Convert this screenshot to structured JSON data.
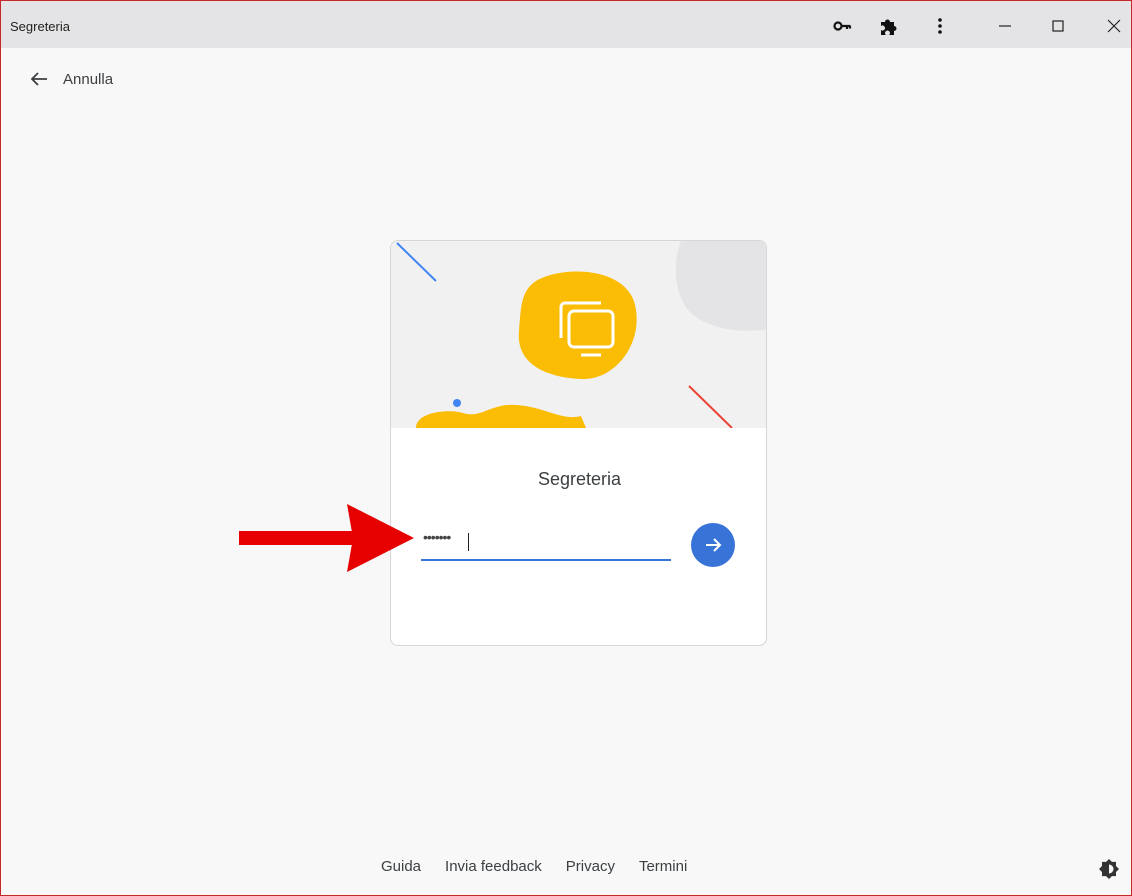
{
  "window": {
    "title": "Segreteria",
    "icons": [
      "key-icon",
      "puzzle-icon",
      "more-vert-icon",
      "minimize-icon",
      "maximize-icon",
      "close-icon"
    ]
  },
  "nav": {
    "back_label": "Annulla"
  },
  "card": {
    "heading": "Segreteria",
    "password_value": "•••••••"
  },
  "footer": {
    "links": [
      "Guida",
      "Invia feedback",
      "Privacy",
      "Termini"
    ]
  },
  "colors": {
    "accent": "#3874d8",
    "yellow": "#fbbc04",
    "red": "#ea4335",
    "annotation_arrow": "#e60000"
  }
}
